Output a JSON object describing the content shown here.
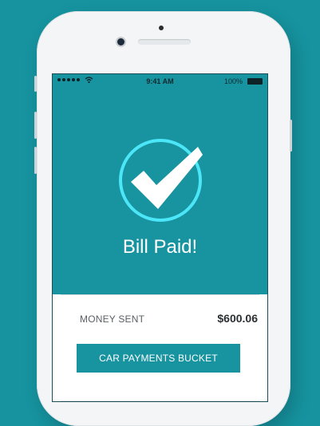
{
  "statusbar": {
    "time": "9:41 AM",
    "battery": "100%",
    "signal_icon": "cellular-dots-icon",
    "wifi_icon": "wifi-icon",
    "battery_icon": "battery-icon"
  },
  "confirmation": {
    "title": "Bill Paid!",
    "icon": "checkmark-circle-icon",
    "accent_color": "#4be6f7"
  },
  "payment": {
    "label": "MONEY SENT",
    "amount": "$600.06"
  },
  "actions": {
    "bucket_button": "CAR PAYMENTS BUCKET"
  },
  "colors": {
    "background": "#16939f",
    "screen": "#1893a0",
    "card": "#ffffff"
  }
}
